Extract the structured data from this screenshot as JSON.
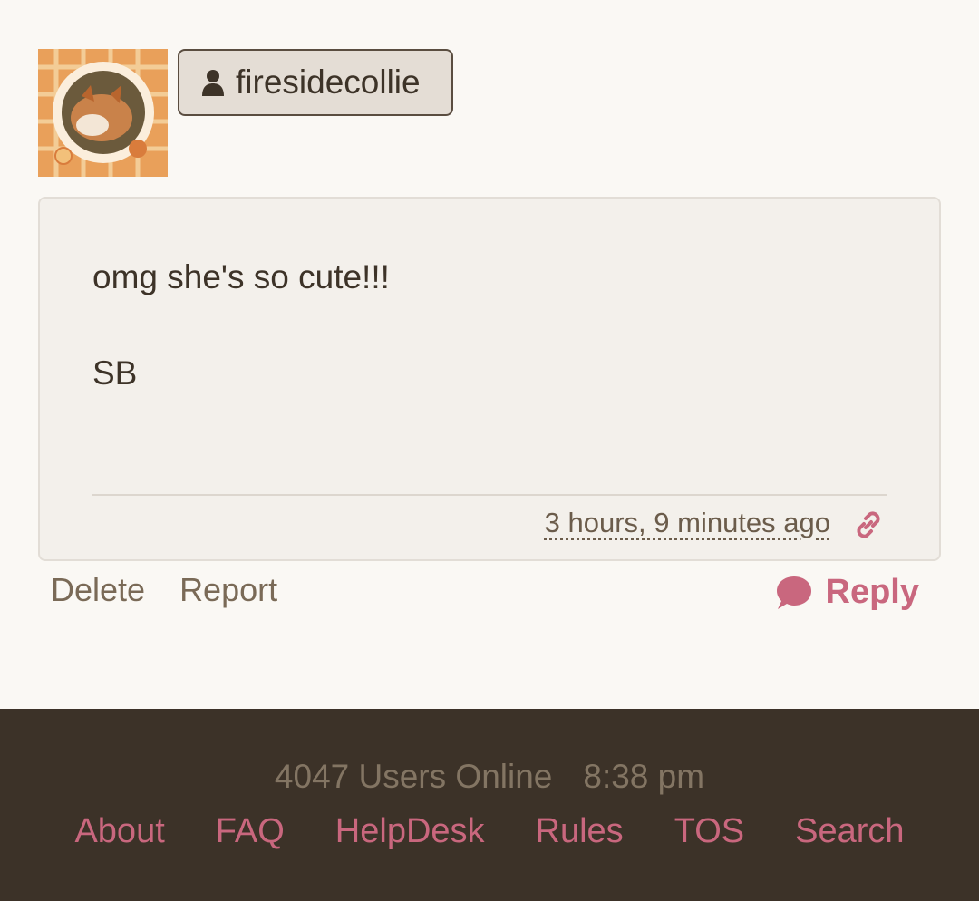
{
  "post": {
    "username": "firesidecollie",
    "text": "omg she's so cute!!!",
    "signature": "SB",
    "timestamp": "3 hours, 9 minutes ago"
  },
  "actions": {
    "delete_label": "Delete",
    "report_label": "Report",
    "reply_label": "Reply"
  },
  "footer": {
    "users_online": "4047 Users Online",
    "time": "8:38 pm",
    "links": [
      "About",
      "FAQ",
      "HelpDesk",
      "Rules",
      "TOS",
      "Search"
    ]
  },
  "colors": {
    "accent": "#c9677e",
    "footer_bg": "#3c3228",
    "page_bg": "#faf8f4"
  },
  "icons": [
    "person-icon",
    "link-icon",
    "speech-bubble-icon"
  ]
}
